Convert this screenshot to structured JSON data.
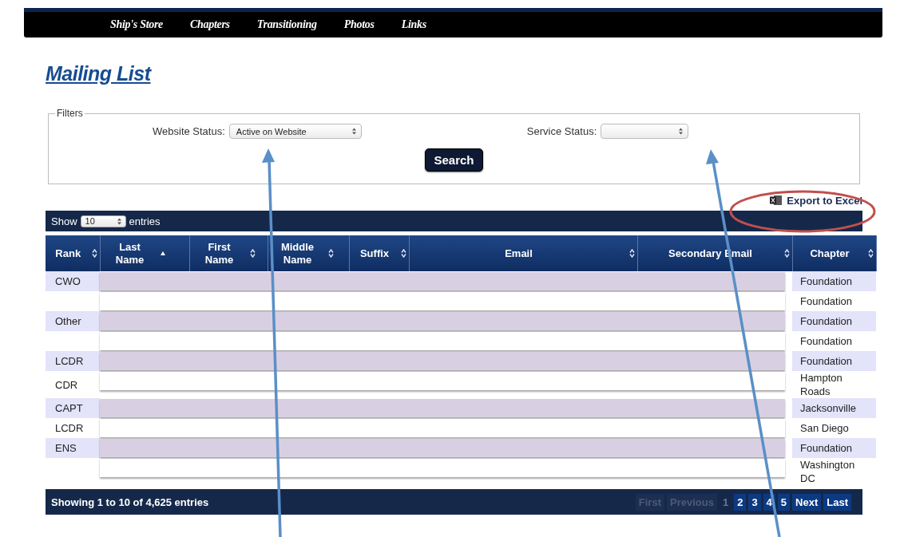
{
  "nav": {
    "items": [
      "Ship's Store",
      "Chapters",
      "Transitioning",
      "Photos",
      "Links"
    ]
  },
  "page_title": "Mailing List",
  "filters": {
    "legend": "Filters",
    "fields": [
      {
        "label": "Website Status:",
        "value": "Active on Website"
      },
      {
        "label": "Service Status:"
      }
    ],
    "search_button": "Search"
  },
  "export_link": "Export to Excel",
  "length_control": {
    "prefix": "Show",
    "value": "10",
    "suffix": "entries"
  },
  "table": {
    "columns": [
      {
        "label": "Rank",
        "sorted": false
      },
      {
        "label": "Last Name",
        "sorted": true
      },
      {
        "label": "First Name",
        "sorted": false
      },
      {
        "label": "Middle Name",
        "sorted": false
      },
      {
        "label": "Suffix",
        "sorted": false
      },
      {
        "label": "Email",
        "sorted": false
      },
      {
        "label": "Secondary Email",
        "sorted": false
      },
      {
        "label": "Chapter",
        "sorted": false
      }
    ],
    "rows": [
      {
        "rank": "CWO",
        "chapter": "Foundation",
        "redacted": true
      },
      {
        "chapter": "Foundation",
        "redacted": true
      },
      {
        "rank": "Other",
        "chapter": "Foundation",
        "redacted": true
      },
      {
        "chapter": "Foundation",
        "redacted": true
      },
      {
        "rank": "LCDR",
        "chapter": "Foundation",
        "redacted": true
      },
      {
        "rank": "CDR",
        "chapter": "Hampton Roads",
        "redacted": true
      },
      {
        "rank": "CAPT",
        "chapter": "Jacksonville",
        "redacted": true
      },
      {
        "rank": "LCDR",
        "chapter": "San Diego",
        "redacted": true
      },
      {
        "rank": "ENS",
        "chapter": "Foundation",
        "redacted": true
      },
      {
        "chapter": "Washington DC",
        "redacted": true
      }
    ]
  },
  "footer": {
    "info": "Showing 1 to 10 of 4,625 entries",
    "pages": [
      {
        "label": "First",
        "disabled": true,
        "selected": false
      },
      {
        "label": "Previous",
        "disabled": true,
        "selected": false
      },
      {
        "label": "1",
        "disabled": false,
        "selected": true
      },
      {
        "label": "2",
        "disabled": false,
        "selected": false
      },
      {
        "label": "3",
        "disabled": false,
        "selected": false
      },
      {
        "label": "4",
        "disabled": false,
        "selected": false
      },
      {
        "label": "5",
        "disabled": false,
        "selected": false
      },
      {
        "label": "Next",
        "disabled": false,
        "selected": false
      },
      {
        "label": "Last",
        "disabled": false,
        "selected": false
      }
    ]
  }
}
